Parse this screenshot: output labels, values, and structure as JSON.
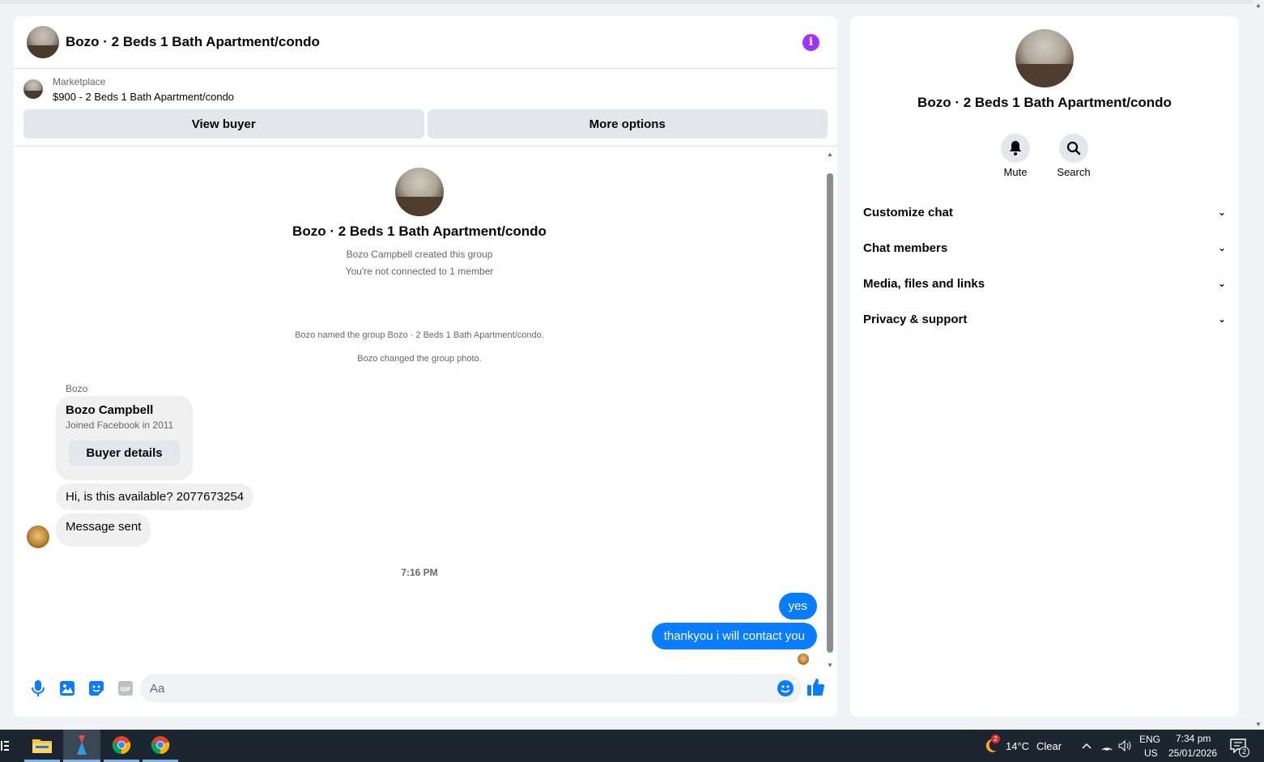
{
  "chat": {
    "title": "Bozo · 2 Beds 1 Bath Apartment/condo",
    "marketplace_label": "Marketplace",
    "listing": "$900 - 2 Beds 1 Bath Apartment/condo",
    "view_buyer_label": "View buyer",
    "more_options_label": "More options",
    "group_name": "Bozo · 2 Beds 1 Bath Apartment/condo",
    "created_by": "Bozo Campbell created this group",
    "not_connected": "You're not connected to 1 member",
    "sys_named": "Bozo named the group Bozo · 2 Beds 1 Bath Apartment/condo.",
    "sys_photo": "Bozo changed the group photo.",
    "sender_label": "Bozo",
    "card": {
      "name": "Bozo Campbell",
      "joined": "Joined Facebook in 2011",
      "button": "Buyer details"
    },
    "incoming": [
      "Hi, is this available? 2077673254",
      "Message sent"
    ],
    "timestamp": "7:16 PM",
    "outgoing": [
      "yes",
      "thankyou i will contact you"
    ],
    "composer_placeholder": "Aa"
  },
  "side": {
    "title": "Bozo · 2 Beds 1 Bath Apartment/condo",
    "mute_label": "Mute",
    "search_label": "Search",
    "sections": [
      "Customize chat",
      "Chat members",
      "Media, files and links",
      "Privacy & support"
    ]
  },
  "taskbar": {
    "weather_temp": "14°C",
    "weather_desc": "Clear",
    "lang_top": "ENG",
    "lang_bottom": "US",
    "time": "7:34 pm",
    "date": "25/01/2026",
    "notif_count": "2",
    "weather_badge": "2"
  },
  "colors": {
    "accent": "#0a7cff",
    "info": "#a033ff",
    "taskbar": "#1c2630"
  }
}
